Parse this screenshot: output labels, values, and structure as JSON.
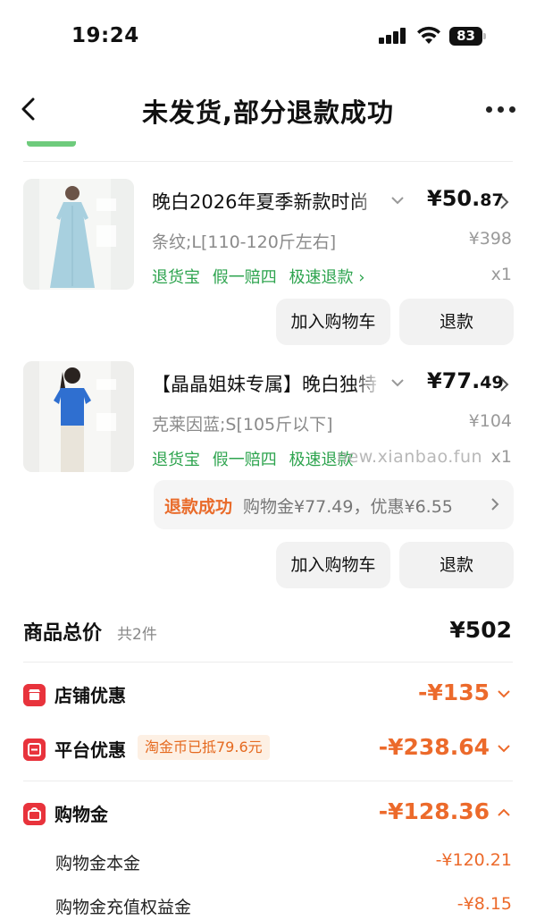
{
  "status_bar": {
    "time": "19:24",
    "battery": "83"
  },
  "nav": {
    "title": "未发货,部分退款成功"
  },
  "products": [
    {
      "title": "晚白2026年夏季新款时尚",
      "price_main": "¥50.",
      "price_cents": "87",
      "spec": "条纹;L[110-120斤左右]",
      "original_price": "¥398",
      "tags": [
        "退货宝",
        "假一赔四",
        "极速退款 ›"
      ],
      "quantity": "x1",
      "buttons": {
        "add_cart": "加入购物车",
        "refund": "退款"
      }
    },
    {
      "title": "【晶晶姐妹专属】晚白独特",
      "price_main": "¥77.",
      "price_cents": "49",
      "spec": "克莱因蓝;S[105斤以下]",
      "original_price": "¥104",
      "tags": [
        "退货宝",
        "假一赔四",
        "极速退款"
      ],
      "quantity": "x1",
      "refund_info": {
        "status": "退款成功",
        "detail": "购物金¥77.49，优惠¥6.55"
      },
      "buttons": {
        "add_cart": "加入购物车",
        "refund": "退款"
      }
    }
  ],
  "watermark": "new.xianbao.fun",
  "summary": {
    "title": "商品总价",
    "count": "共2件",
    "total": "¥502"
  },
  "discounts": [
    {
      "label": "店铺优惠",
      "amount": "-¥135",
      "badge": ""
    },
    {
      "label": "平台优惠",
      "amount": "-¥238.64",
      "badge": "淘金币已抵79.6元"
    },
    {
      "label": "购物金",
      "amount": "-¥128.36",
      "badge": ""
    }
  ],
  "shopping_credit_detail": [
    {
      "label": "购物金本金",
      "amount": "-¥120.21"
    },
    {
      "label": "购物金充值权益金",
      "amount": "-¥8.15"
    }
  ],
  "colors": {
    "accent_orange": "#ec6a2b",
    "tag_green": "#2ea44f",
    "icon_red": "#e8333c"
  }
}
